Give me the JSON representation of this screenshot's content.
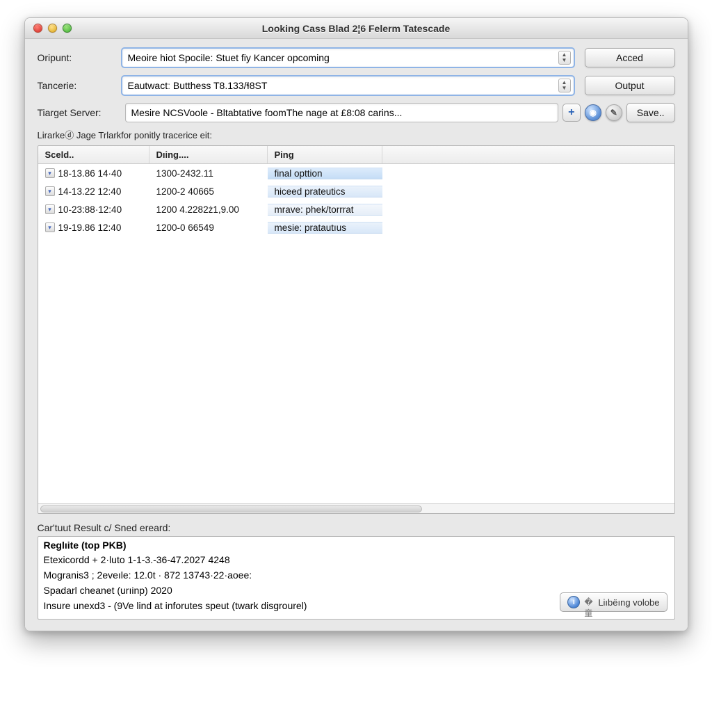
{
  "window": {
    "title": "Looking Cass Blad 2¦6 Felerm Tatescade"
  },
  "form": {
    "oripunt": {
      "label": "Oripunt:",
      "value": "Meoire hiot Spocile: Stuet fiy Kancer opcoming"
    },
    "tancerie": {
      "label": "Tancerie:",
      "value": "Eautwactː Butthess T8.133/ɬ8ST"
    },
    "target": {
      "label": "Tiarget Server:",
      "value": "Mesire NCSVoole - Bltabtative foomThe nage at £8:08 carins..."
    }
  },
  "buttons": {
    "acced": "Acced",
    "output": "Output",
    "save": "Save..",
    "bottom": "Liıbёıng volobe"
  },
  "list": {
    "heading": "Lirarkeⓓ Jage Trlarkfor ponitly tracerice eit:",
    "columns": {
      "c1": "Sceld..",
      "c2": "Dıing....",
      "c3": "Ping",
      "c4": ""
    },
    "rows": [
      {
        "c1": "18-13.86 14·40",
        "c2": "1300-2432.11",
        "c3": "final opttion"
      },
      {
        "c1": "14-13.22 12:40",
        "c2": "1200-2 40665",
        "c3": "hiceed prateutics"
      },
      {
        "c1": "10-23:88·12:40",
        "c2": "1200 4.2282ż1,9.00",
        "c3": "mrave: phek/torrrat"
      },
      {
        "c1": "19-19.86 12:40",
        "c2": "1200-0 66549",
        "c3": "mesie: pratautıus"
      }
    ]
  },
  "result": {
    "label": "Car'tuut Result c/ Sned ereard:",
    "head": "Reglıite (top PKB)",
    "lines": [
      "Etexicordd  + 2·luto 1-1-3.-36-47.2027 4248",
      "Mogranis3 ;  2eveıle: 12.0t · 872 13743·22·aoee:",
      "Spadarl cheanet (urıinp) 2020",
      "Insure unexd3 - (9Ve lind at inforutes speut (twark disgrourel)"
    ]
  }
}
